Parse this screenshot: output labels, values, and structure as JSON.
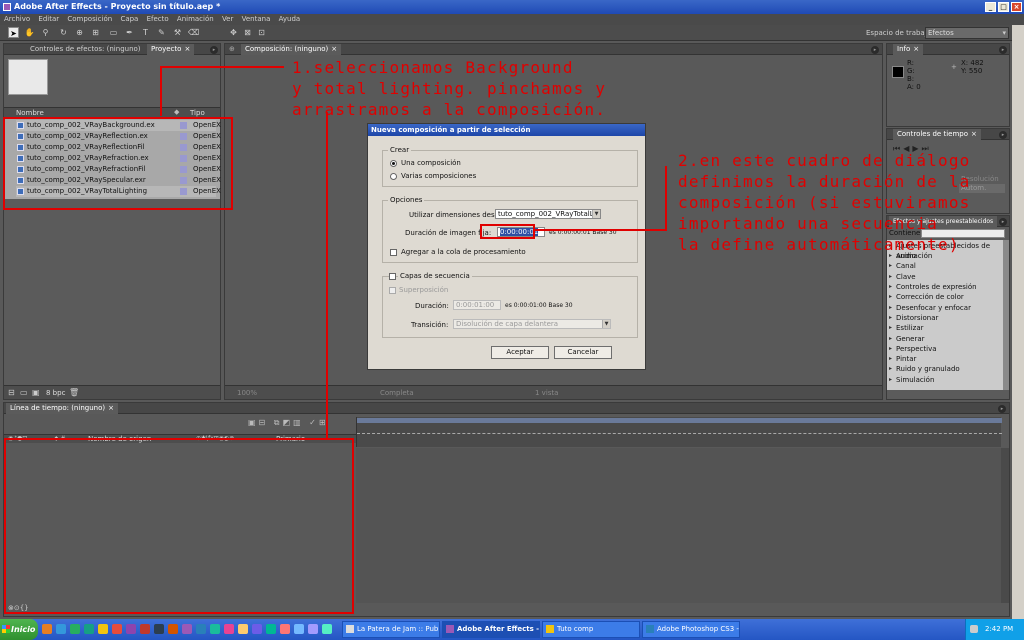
{
  "window": {
    "title": "Adobe After Effects - Proyecto sin título.aep *"
  },
  "menu": [
    "Archivo",
    "Editar",
    "Composición",
    "Capa",
    "Efecto",
    "Animación",
    "Ver",
    "Ventana",
    "Ayuda"
  ],
  "toolbar": {
    "workspace_label": "Espacio de trabajo:",
    "workspace_value": "Efectos"
  },
  "effects_panel": {
    "tab_label": "Controles de efectos: (ninguno)"
  },
  "project_panel": {
    "tab_label": "Proyecto",
    "col_name": "Nombre",
    "col_type": "Tipo",
    "items": [
      {
        "name": "tuto_comp_002_VRayBackground.ex",
        "type": "OpenEX"
      },
      {
        "name": "tuto_comp_002_VRayReflection.ex",
        "type": "OpenEX"
      },
      {
        "name": "tuto_comp_002_VRayReflectionFil",
        "type": "OpenEX"
      },
      {
        "name": "tuto_comp_002_VRayRefraction.ex",
        "type": "OpenEX"
      },
      {
        "name": "tuto_comp_002_VRayRefractionFil",
        "type": "OpenEX"
      },
      {
        "name": "tuto_comp_002_VRaySpecular.exr",
        "type": "OpenEX"
      },
      {
        "name": "tuto_comp_002_VRayTotalLighting",
        "type": "OpenEX"
      }
    ],
    "bpc": "8 bpc"
  },
  "comp_panel": {
    "tab_label": "Composición: (ninguno)",
    "zoom": "100%",
    "resolution": "Completa",
    "view": "1 vista"
  },
  "info_panel": {
    "tab_label": "Info",
    "r": "R:",
    "g": "G:",
    "b": "B:",
    "a": "A: 0",
    "x": "X: 482",
    "y": "Y: 550"
  },
  "time_controls": {
    "tab_label": "Controles de tiempo",
    "quality_label": "Resolución",
    "auto": "Autom."
  },
  "effects_presets": {
    "tab_label": "Efectos y ajustes preestablecidos",
    "contains_label": "Contiene:",
    "categories": [
      "Ajustes preestablecidos de animación",
      "Audio",
      "Canal",
      "Clave",
      "Controles de expresión",
      "Corrección de color",
      "Desenfocar y enfocar",
      "Distorsionar",
      "Estilizar",
      "Generar",
      "Perspectiva",
      "Pintar",
      "Ruido y granulado",
      "Simulación"
    ]
  },
  "timeline": {
    "tab_label": "Línea de tiempo: (ninguno)",
    "col_source": "Nombre de origen",
    "col_parent": "Primario"
  },
  "dialog": {
    "title": "Nueva composición a partir de selección",
    "group_create": "Crear",
    "opt_single": "Una composición",
    "opt_multiple": "Varias composiciones",
    "group_options": "Opciones",
    "use_dims_label": "Utilizar dimensiones desde:",
    "use_dims_value": "tuto_comp_002_VRayTotalL",
    "still_dur_label": "Duración de imagen fija:",
    "still_dur_value": "0:00:00:01",
    "still_dur_info": "es 0:00:00:01  Base 30",
    "add_render_queue": "Agregar a la cola de procesamiento",
    "group_sequence": "Capas de secuencia",
    "overlap_label": "Superposición",
    "duration_label": "Duración:",
    "duration_value": "0:00:01:00",
    "duration_info": "es 0:00:01:00  Base 30",
    "transition_label": "Transición:",
    "transition_value": "Disolución de capa delantera",
    "ok_label": "Aceptar",
    "cancel_label": "Cancelar"
  },
  "annotations": {
    "note1_l1": "1.seleccionamos Background",
    "note1_l2": "y total lighting. pinchamos y",
    "note1_l3": "arrastramos a la composición.",
    "note2_l1": "2.en este cuadro de diálogo",
    "note2_l2": "definimos la duración de la",
    "note2_l3": "composición (si estuviramos",
    "note2_l4": "importando una secuencia",
    "note2_l5": "la define automáticamente)"
  },
  "taskbar": {
    "start": "Inicio",
    "items": [
      {
        "label": "La Patera de Jam :: Publi..."
      },
      {
        "label": "Adobe After Effects - ..."
      },
      {
        "label": "Tuto comp"
      },
      {
        "label": "Adobe Photoshop CS3 - ..."
      }
    ],
    "clock": "2:42 PM"
  },
  "colors": {
    "annotation_red": "#e00000",
    "title_blue": "#2a56c0",
    "panel_gray": "#5b5b5b"
  }
}
